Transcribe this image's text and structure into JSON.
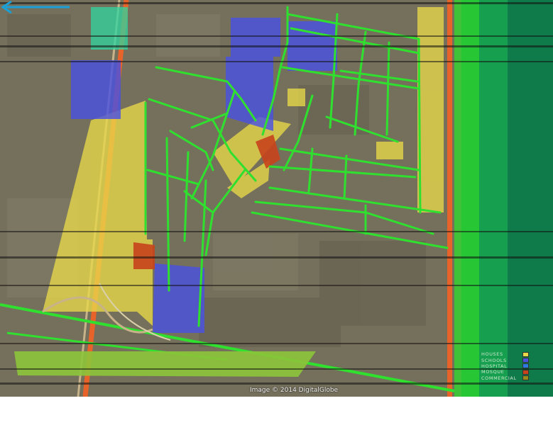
{
  "image_credit": "Image © 2014 DigitalGlobe",
  "roads": {
    "main_road_label": "",
    "street_label": "",
    "coastal_road_label": ""
  },
  "direction_label": "",
  "legend": {
    "items": [
      {
        "label": "Houses",
        "color": "#e8d94a"
      },
      {
        "label": "Schools",
        "color": "#4a52e0"
      },
      {
        "label": "Hospital",
        "color": "#2d7be0"
      },
      {
        "label": "Mosque",
        "color": "#c8421c"
      },
      {
        "label": "Commercial",
        "color": "#9a8a1a"
      }
    ]
  },
  "colors": {
    "street_green": "#2fe02f",
    "sea_green": "#0f7a4a",
    "arterial_orange": "#e8632a",
    "houses": "#e8d94a",
    "schools": "#4a52e0",
    "mosque": "#c8421c",
    "direction_arrow": "#1aa0d8"
  }
}
